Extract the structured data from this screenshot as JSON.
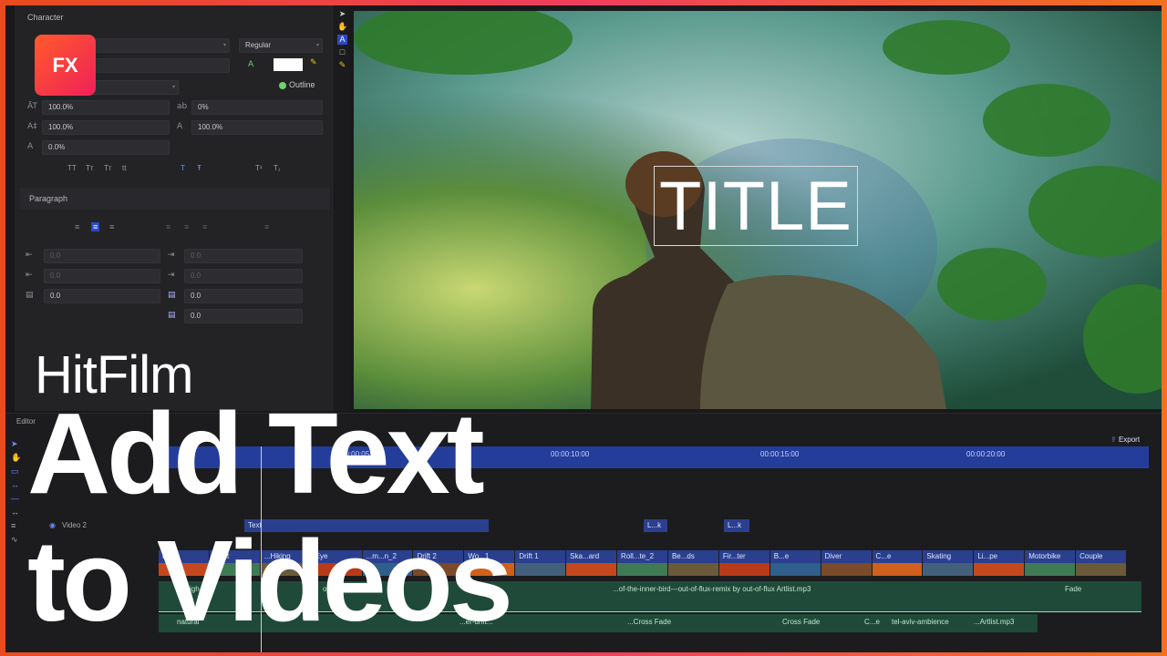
{
  "character": {
    "header": "Character",
    "weight": "Regular",
    "outline_label": "Outline",
    "fields": {
      "scale_v": "100.0%",
      "tracking": "0%",
      "scale_h": "100.0%",
      "kerning": "100.0%",
      "baseline": "0.0%"
    },
    "styles": [
      "TT",
      "Tт",
      "Tт",
      "tt"
    ],
    "super": [
      "T¹",
      "T₁"
    ]
  },
  "paragraph": {
    "header": "Paragraph",
    "fields": [
      "0.0",
      "0.0",
      "0.0",
      "0.0",
      "0.0",
      "0.0",
      "0.0"
    ]
  },
  "viewer": {
    "title_text": "TITLE"
  },
  "editor": {
    "label": "Editor",
    "export_label": "Export",
    "ticks": [
      "00:00:05:00",
      "00:00:10:00",
      "00:00:15:00",
      "00:00:20:00"
    ],
    "track_label": "Video 2",
    "text_clip": "Text",
    "clips_top": [
      "L...k",
      "L...k"
    ],
    "clips": [
      "F...",
      "...est",
      "...Hiking",
      "Eye",
      "...m...n_2",
      "Drift 2",
      "Wo...1",
      "Drift 1",
      "Ska...ard",
      "Roll...te_2",
      "Be...ds",
      "Fir...ter",
      "B...e",
      "Diver",
      "C...e",
      "Skating",
      "Li...pe",
      "Motorbike",
      "Couple"
    ],
    "audio1": [
      "fligh",
      "out-of-fl",
      "...of-the-inner-bird---out-of-flux-remix by out-of-flux Artlist.mp3",
      "Fade"
    ],
    "audio2": [
      "natural",
      "...er-drift...",
      "...Cross Fade",
      "Cross Fade",
      "C...e",
      "tel-aviv-ambience",
      "...Artlist.mp3"
    ]
  },
  "overlay": {
    "logo": "FX",
    "line1": "HitFilm",
    "line2": "Add Text",
    "line3": "to Videos"
  },
  "colors": {
    "accent": "#243d9b",
    "brand_start": "#ff5a2a",
    "brand_end": "#f0205a"
  }
}
